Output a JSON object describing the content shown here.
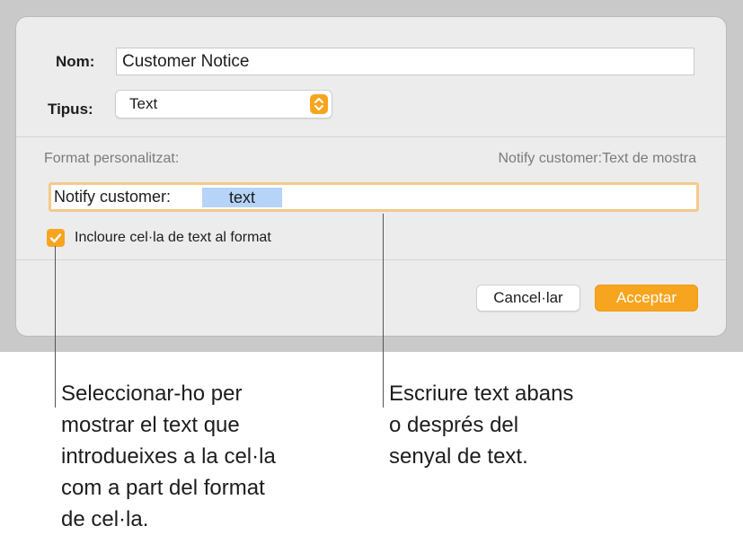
{
  "dialog": {
    "name_label": "Nom:",
    "name_value": "Customer Notice",
    "type_label": "Tipus:",
    "type_value": "Text",
    "custom_format_label": "Format personalitzat:",
    "preview_text": "Notify customer:Text de mostra",
    "format_prefix": "Notify customer:",
    "format_token": "text",
    "include_checkbox_label": "Incloure cel·la de text al format",
    "include_checked": true,
    "cancel_label": "Cancel·lar",
    "ok_label": "Acceptar",
    "accent_color": "#f7a51e",
    "token_color": "#b6d3f8"
  },
  "callouts": {
    "checkbox_lines": [
      "Seleccionar-ho per",
      "mostrar el text que",
      "introdueixes a la cel·la",
      "com a part del format",
      "de cel·la."
    ],
    "field_lines": [
      "Escriure text abans",
      "o després del",
      "senyal de text."
    ]
  }
}
